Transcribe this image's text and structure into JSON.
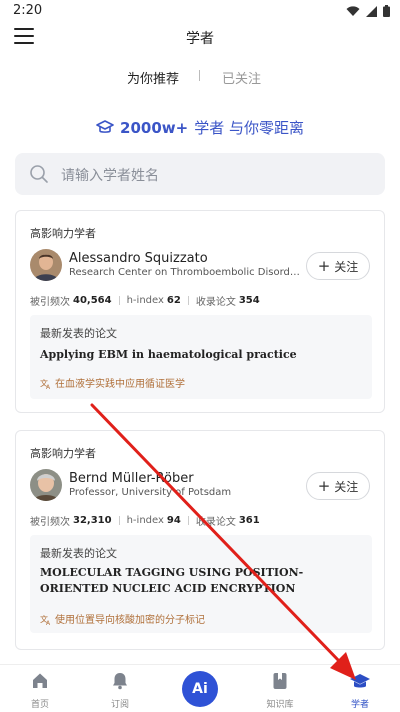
{
  "status": {
    "time": "2:20"
  },
  "header": {
    "title": "学者"
  },
  "tabs": [
    {
      "label": "为你推荐"
    },
    {
      "label": "已关注"
    }
  ],
  "slogan": {
    "strong": "2000w+",
    "rest": "学者 与你零距离"
  },
  "search": {
    "placeholder": "请输入学者姓名"
  },
  "scholars": [
    {
      "kicker": "高影响力学者",
      "name": "Alessandro Squizzato",
      "institution": "Research Center on Thromboembolic Disorders and Antithrombotic Therapies",
      "follow": "关注",
      "metrics": {
        "citations_label": "被引频次",
        "citations": "40,564",
        "hindex_label": "h-index",
        "hindex": "62",
        "papers_label": "收录论文",
        "papers": "354"
      },
      "paper": {
        "label": "最新发表的论文",
        "title": "Applying EBM in haematological practice",
        "title_cn": "在血液学实践中应用循证医学"
      }
    },
    {
      "kicker": "高影响力学者",
      "name": "Bernd Müller-Röber",
      "institution": "Professor, University of Potsdam",
      "follow": "关注",
      "metrics": {
        "citations_label": "被引频次",
        "citations": "32,310",
        "hindex_label": "h-index",
        "hindex": "94",
        "papers_label": "收录论文",
        "papers": "361"
      },
      "paper": {
        "label": "最新发表的论文",
        "title": "MOLECULAR TAGGING USING POSITION-ORIENTED NUCLEIC ACID ENCRYPTION",
        "title_cn": "使用位置导向核酸加密的分子标记"
      }
    }
  ],
  "nav": [
    {
      "label": "首页",
      "icon": "home-icon"
    },
    {
      "label": "订阅",
      "icon": "bell-icon"
    },
    {
      "label": "Ai",
      "icon": "ai-icon"
    },
    {
      "label": "知识库",
      "icon": "bookmark-icon"
    },
    {
      "label": "学者",
      "icon": "scholar-cap-icon"
    }
  ],
  "colors": {
    "accent": "#2f52d6",
    "annotation_arrow": "#e0201a",
    "paper_cn": "#b0703a"
  }
}
